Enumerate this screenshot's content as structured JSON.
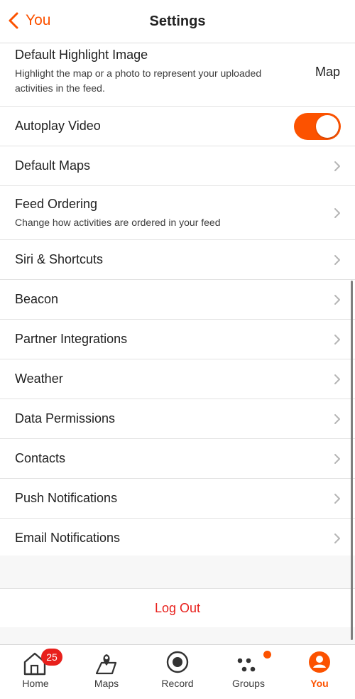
{
  "header": {
    "back_label": "You",
    "title": "Settings"
  },
  "highlight": {
    "label": "Default Highlight Image",
    "sub_line1": "Highlight the map or a photo to represent your uploaded",
    "sub_line2": "activities in the feed.",
    "value": "Map"
  },
  "autoplay": {
    "label": "Autoplay Video",
    "enabled": true
  },
  "rows": {
    "default_maps": "Default Maps",
    "feed_ordering": "Feed Ordering",
    "feed_ordering_sub": "Change how activities are ordered in your feed",
    "siri": "Siri & Shortcuts",
    "beacon": "Beacon",
    "partner": "Partner Integrations",
    "weather": "Weather",
    "data_permissions": "Data Permissions",
    "contacts": "Contacts",
    "push": "Push Notifications",
    "email": "Email Notifications"
  },
  "logout_label": "Log Out",
  "tabs": {
    "home": "Home",
    "home_badge": "25",
    "maps": "Maps",
    "record": "Record",
    "groups": "Groups",
    "you": "You"
  },
  "colors": {
    "accent": "#fc5200",
    "logout": "#e8201c",
    "badge": "#e8201c"
  }
}
